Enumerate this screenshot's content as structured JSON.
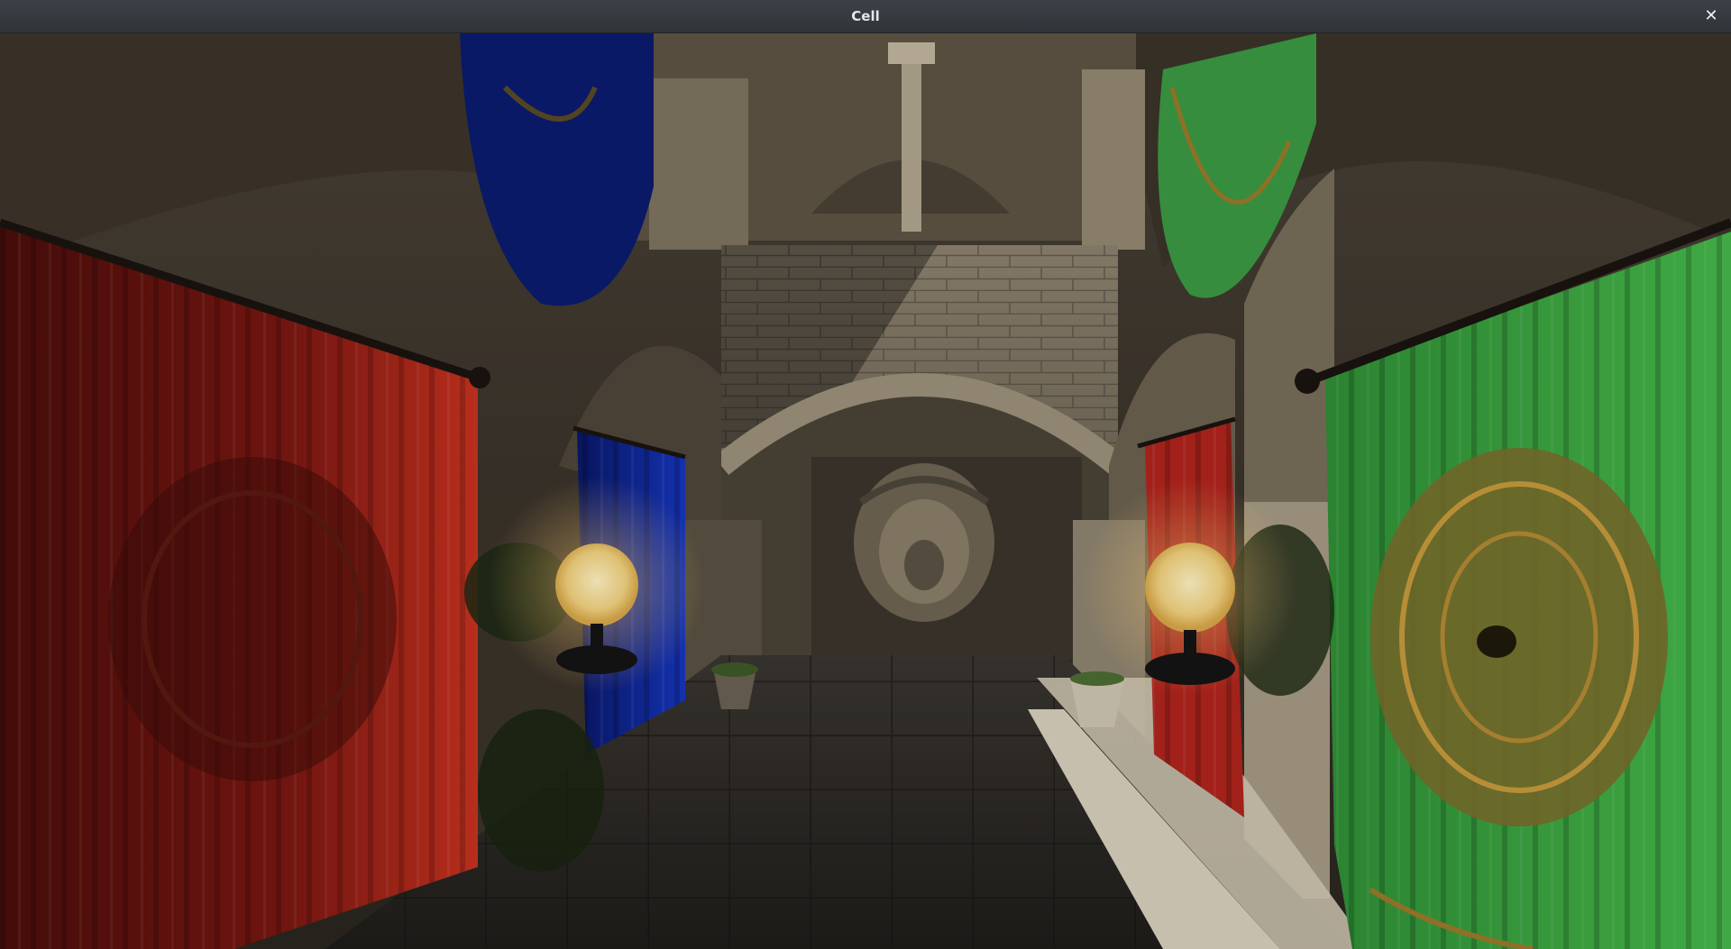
{
  "window": {
    "title": "Cell",
    "close_glyph": "✕"
  },
  "viewport": {
    "scene": "sponza-atrium-render",
    "colors": {
      "curtain_red": "#b3261e",
      "curtain_blue": "#0d1f8a",
      "curtain_green": "#3fae45",
      "lamp_glow": "#f7d98a",
      "stone": "#8a7f6e"
    }
  }
}
